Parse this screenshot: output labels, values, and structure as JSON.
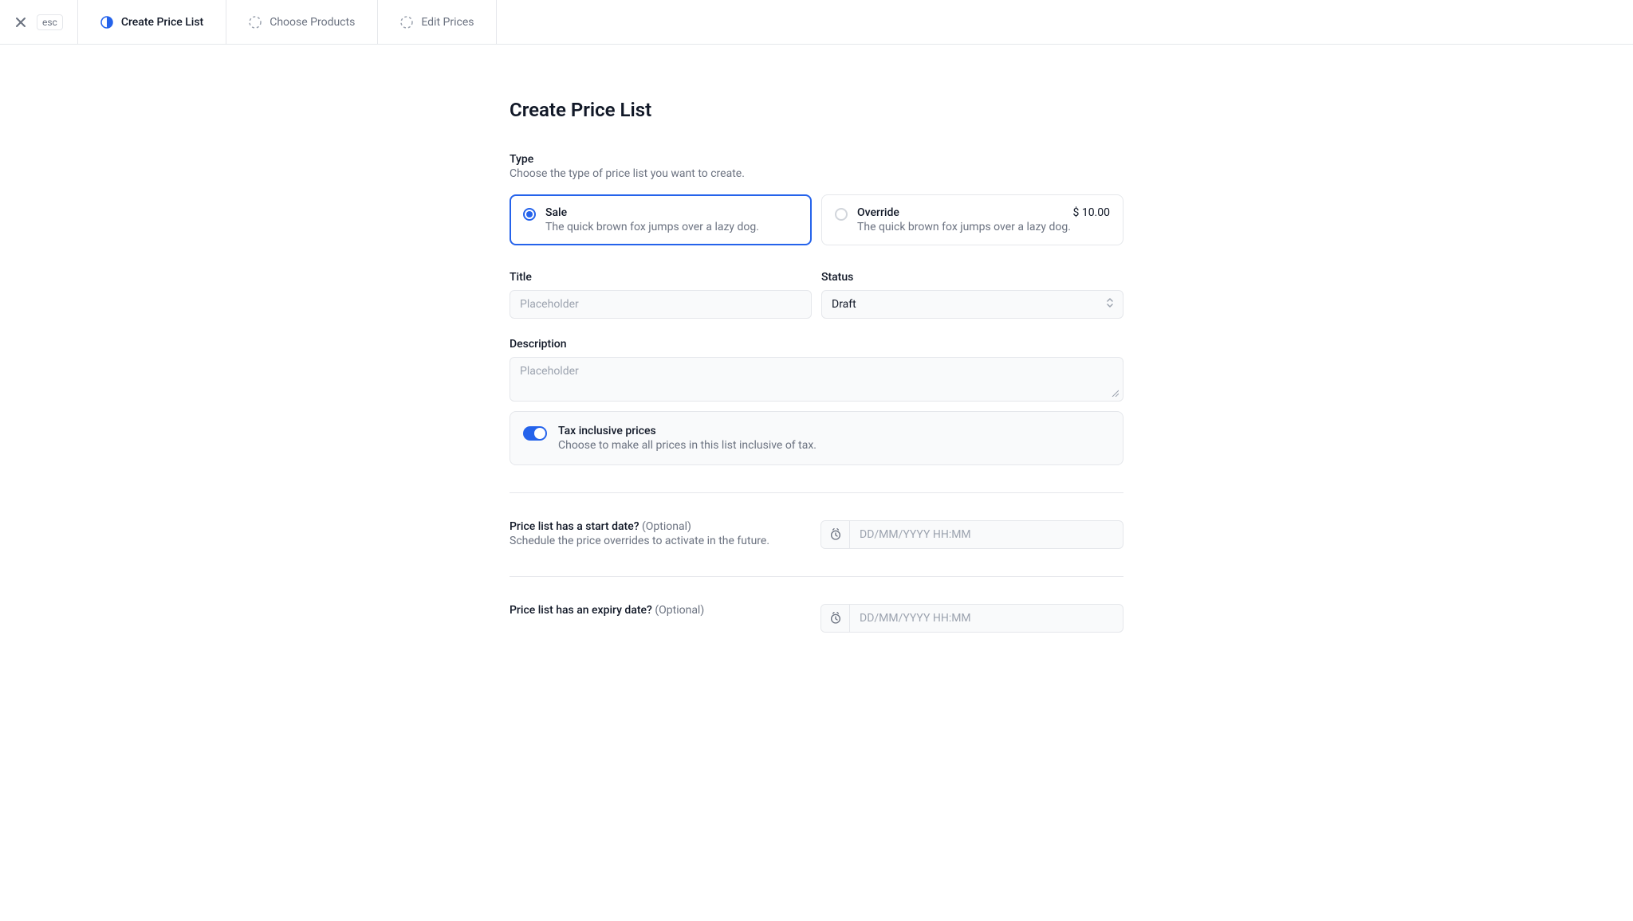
{
  "topbar": {
    "esc_label": "esc",
    "tabs": [
      {
        "label": "Create Price List",
        "active": true
      },
      {
        "label": "Choose Products",
        "active": false
      },
      {
        "label": "Edit Prices",
        "active": false
      }
    ]
  },
  "page": {
    "title": "Create Price List",
    "type_section": {
      "label": "Type",
      "sub": "Choose the type of price list you want to create.",
      "options": [
        {
          "title": "Sale",
          "desc": "The quick brown fox jumps over a lazy dog.",
          "selected": true
        },
        {
          "title": "Override",
          "desc": "The quick brown fox jumps over a lazy dog.",
          "price": "$ 10.00",
          "selected": false
        }
      ]
    },
    "title_field": {
      "label": "Title",
      "placeholder": "Placeholder",
      "value": ""
    },
    "status_field": {
      "label": "Status",
      "value": "Draft"
    },
    "description_field": {
      "label": "Description",
      "placeholder": "Placeholder",
      "value": ""
    },
    "tax_toggle": {
      "title": "Tax inclusive prices",
      "desc": "Choose to make all prices in this list inclusive of tax.",
      "on": true
    },
    "start_date": {
      "question": "Price list has a start date?",
      "optional": "(Optional)",
      "sub": "Schedule the price overrides to activate in the future.",
      "placeholder": "DD/MM/YYYY HH:MM"
    },
    "expiry_date": {
      "question": "Price list has an expiry date?",
      "optional": "(Optional)",
      "placeholder": "DD/MM/YYYY HH:MM"
    }
  }
}
